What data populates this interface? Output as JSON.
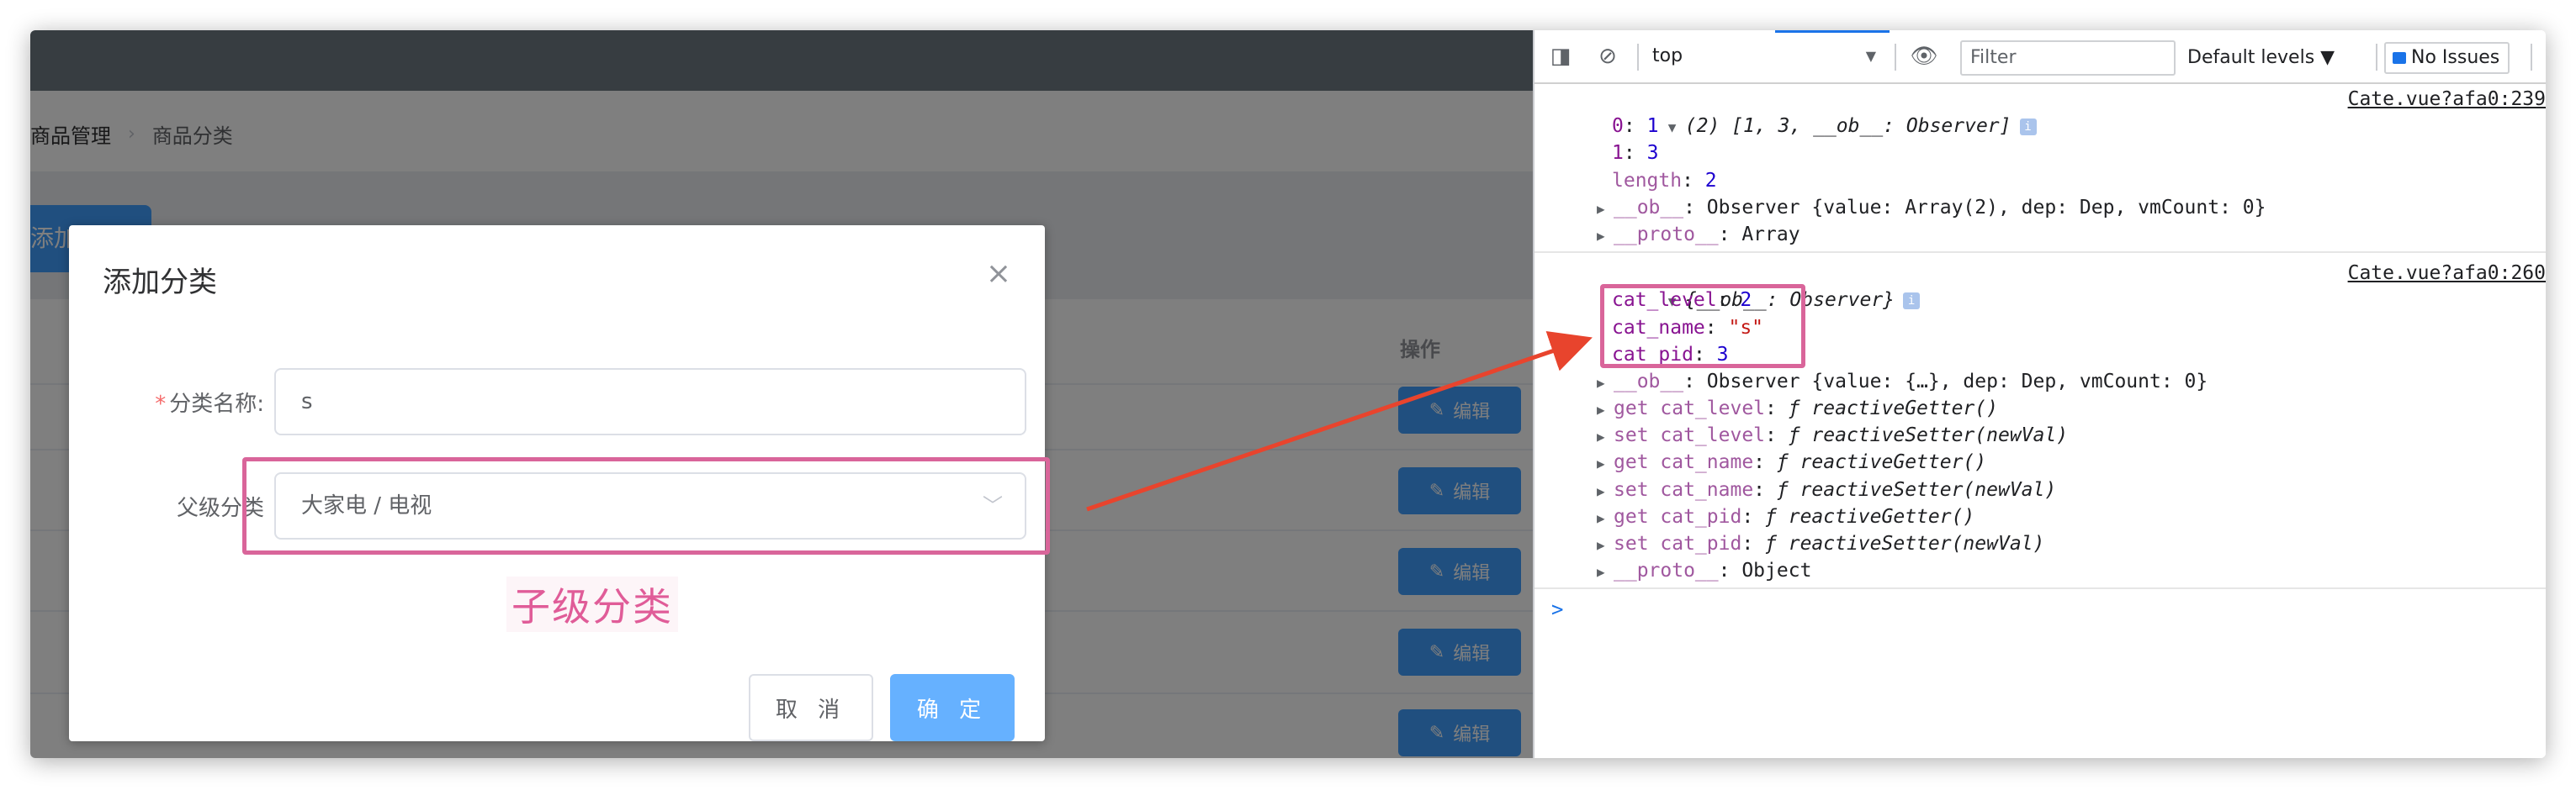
{
  "app": {
    "breadcrumb": [
      "商品管理",
      "商品分类"
    ],
    "add_button": "添加",
    "table": {
      "header_op": "操作",
      "edit_label": "编辑",
      "rows": 5
    },
    "dialog": {
      "title": "添加分类",
      "name_label": "分类名称:",
      "name_required_mark": "*",
      "name_value": "s",
      "parent_label": "父级分类",
      "parent_value": "大家电 / 电视",
      "annotation": "子级分类",
      "cancel": "取 消",
      "confirm": "确 定"
    }
  },
  "devtools": {
    "context": "top",
    "filter_placeholder": "Filter",
    "levels": "Default levels ▼",
    "issues": "No Issues",
    "groups": [
      {
        "header": "(2) [1, 3, __ob__: Observer]",
        "source": "Cate.vue?afa0:239",
        "lines": [
          {
            "key": "0",
            "value": "1"
          },
          {
            "key": "1",
            "value": "3"
          },
          {
            "key": "length",
            "value": "2"
          },
          {
            "key": "__ob__",
            "value": "Observer {value: Array(2), dep: Dep, vmCount: 0}"
          },
          {
            "key": "__proto__",
            "value": "Array"
          }
        ]
      },
      {
        "header": "{__ob__: Observer}",
        "source": "Cate.vue?afa0:260",
        "lines": [
          {
            "key": "cat_level",
            "value": "2"
          },
          {
            "key": "cat_name",
            "value": "\"s\""
          },
          {
            "key": "cat_pid",
            "value": "3"
          },
          {
            "key": "__ob__",
            "value": "Observer {value: {…}, dep: Dep, vmCount: 0}"
          },
          {
            "key": "get cat_level",
            "value": "ƒ reactiveGetter()"
          },
          {
            "key": "set cat_level",
            "value": "ƒ reactiveSetter(newVal)"
          },
          {
            "key": "get cat_name",
            "value": "ƒ reactiveGetter()"
          },
          {
            "key": "set cat_name",
            "value": "ƒ reactiveSetter(newVal)"
          },
          {
            "key": "get cat_pid",
            "value": "ƒ reactiveGetter()"
          },
          {
            "key": "set cat_pid",
            "value": "ƒ reactiveSetter(newVal)"
          },
          {
            "key": "__proto__",
            "value": "Object"
          }
        ]
      }
    ],
    "prompt": ">"
  },
  "colors": {
    "accent": "#409eff",
    "highlight": "#d9659a",
    "arrow": "#e8442d",
    "topbar": "#373d41"
  }
}
